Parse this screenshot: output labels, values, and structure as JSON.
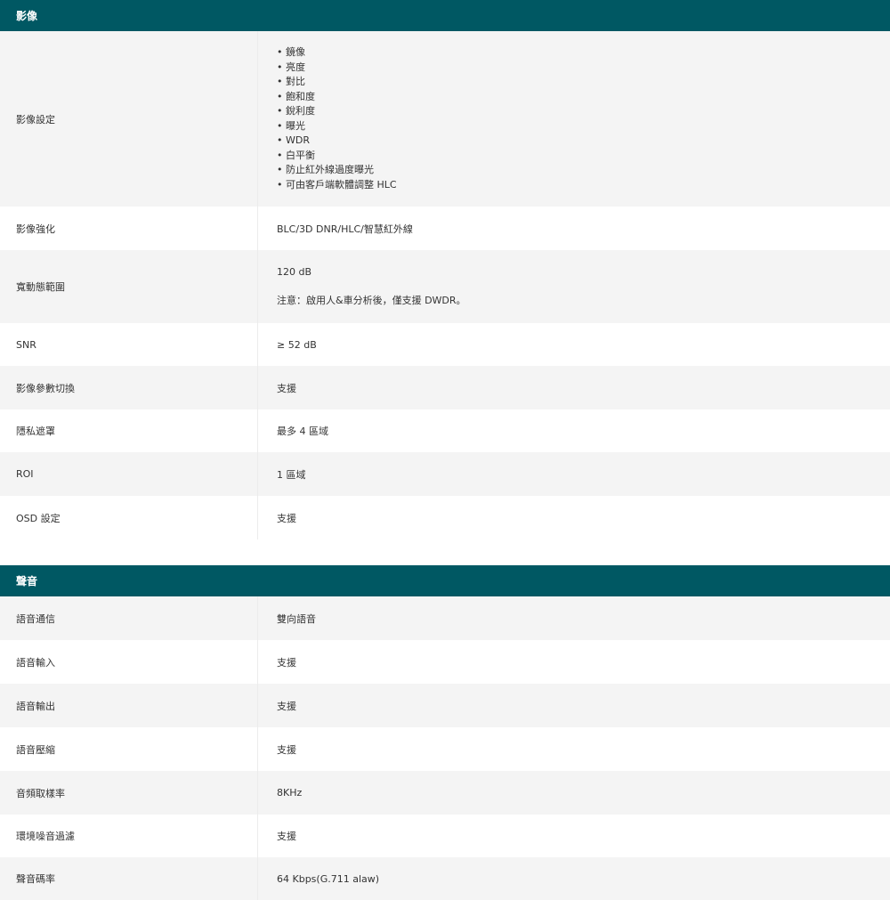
{
  "image_section": {
    "title": "影像",
    "image_settings": {
      "label": "影像設定",
      "items": [
        "鏡像",
        "亮度",
        "對比",
        "飽和度",
        "銳利度",
        "曝光",
        "WDR",
        "白平衡",
        "防止紅外線過度曝光",
        "可由客戶端軟體調整 HLC"
      ]
    },
    "rows": [
      {
        "label": "影像強化",
        "value": "BLC/3D DNR/HLC/智慧紅外線"
      }
    ],
    "wdr": {
      "label": "寬動態範圍",
      "value": "120 dB",
      "note": "注意：啟用人&車分析後，僅支援 DWDR。"
    },
    "rows2": [
      {
        "label": "SNR",
        "value": "≥ 52 dB"
      },
      {
        "label": "影像參數切換",
        "value": "支援"
      },
      {
        "label": "隱私遮罩",
        "value": "最多 4 區域"
      },
      {
        "label": "ROI",
        "value": "1 區域"
      },
      {
        "label": "OSD 設定",
        "value": "支援"
      }
    ]
  },
  "audio_section": {
    "title": "聲音",
    "rows": [
      {
        "label": "語音通信",
        "value": "雙向語音"
      },
      {
        "label": "語音輸入",
        "value": "支援"
      },
      {
        "label": "語音輸出",
        "value": "支援"
      },
      {
        "label": "語音壓縮",
        "value": "支援"
      },
      {
        "label": "音頻取樣率",
        "value": "8KHz"
      },
      {
        "label": "環境噪音過濾",
        "value": "支援"
      },
      {
        "label": "聲音碼率",
        "value": "64 Kbps(G.711 alaw)"
      }
    ]
  }
}
